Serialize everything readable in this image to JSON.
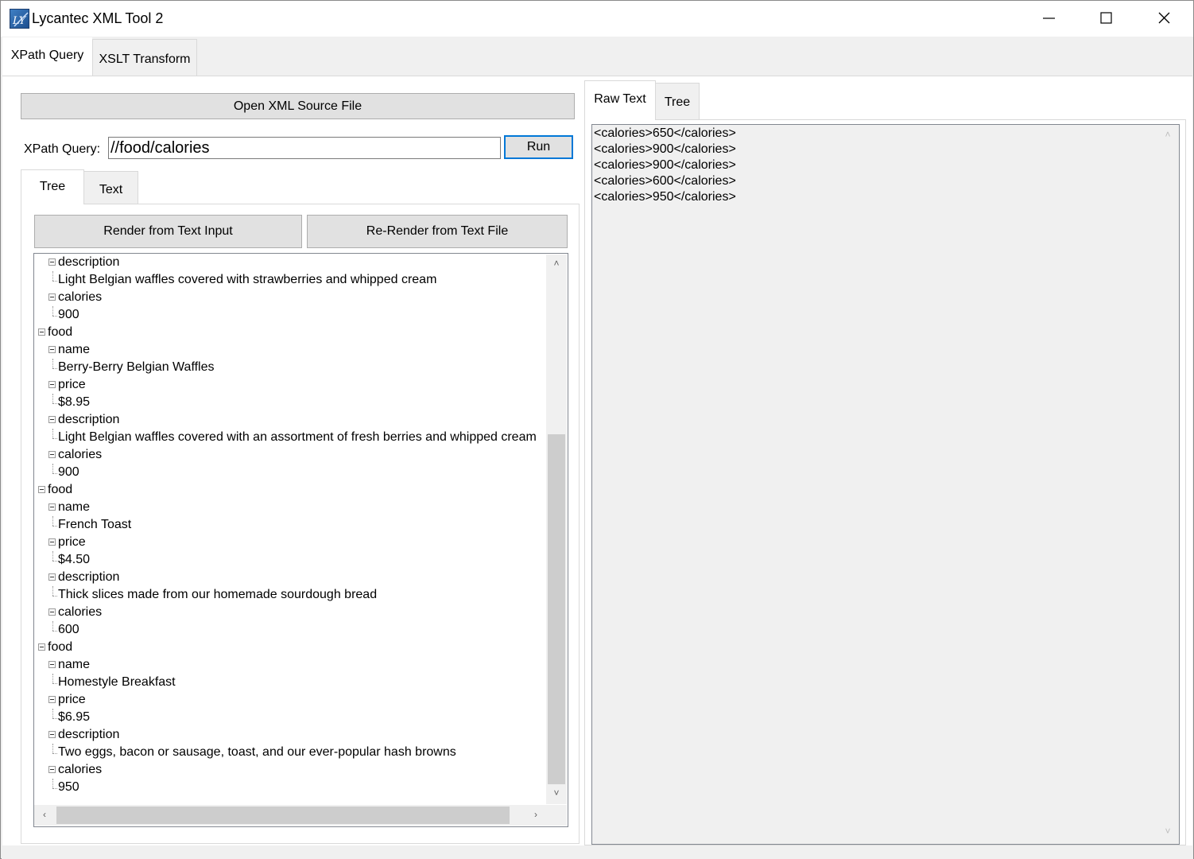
{
  "window": {
    "title": "Lycantec XML Tool 2",
    "icon": "lycantec-logo-icon"
  },
  "top_tabs": [
    {
      "label": "XPath Query",
      "active": true
    },
    {
      "label": "XSLT Transform",
      "active": false
    }
  ],
  "toolbar": {
    "open_button": "Open XML Source File",
    "xpath_label": "XPath Query:",
    "xpath_value": "//food/calories",
    "run_button": "Run"
  },
  "left_tabs": [
    {
      "label": "Tree",
      "active": true
    },
    {
      "label": "Text",
      "active": false
    }
  ],
  "render_buttons": {
    "from_text_input": "Render from Text Input",
    "from_text_file": "Re-Render from Text File"
  },
  "tree": [
    {
      "level": 1,
      "text": "description",
      "node": true
    },
    {
      "level": 2,
      "text": "Light Belgian waffles covered with strawberries and whipped cream",
      "node": false
    },
    {
      "level": 1,
      "text": "calories",
      "node": true
    },
    {
      "level": 2,
      "text": "900",
      "node": false
    },
    {
      "level": 0,
      "text": "food",
      "node": true
    },
    {
      "level": 1,
      "text": "name",
      "node": true
    },
    {
      "level": 2,
      "text": "Berry-Berry Belgian Waffles",
      "node": false
    },
    {
      "level": 1,
      "text": "price",
      "node": true
    },
    {
      "level": 2,
      "text": "$8.95",
      "node": false
    },
    {
      "level": 1,
      "text": "description",
      "node": true
    },
    {
      "level": 2,
      "text": "Light Belgian waffles covered with an assortment of fresh berries and whipped cream",
      "node": false
    },
    {
      "level": 1,
      "text": "calories",
      "node": true
    },
    {
      "level": 2,
      "text": "900",
      "node": false
    },
    {
      "level": 0,
      "text": "food",
      "node": true
    },
    {
      "level": 1,
      "text": "name",
      "node": true
    },
    {
      "level": 2,
      "text": "French Toast",
      "node": false
    },
    {
      "level": 1,
      "text": "price",
      "node": true
    },
    {
      "level": 2,
      "text": "$4.50",
      "node": false
    },
    {
      "level": 1,
      "text": "description",
      "node": true
    },
    {
      "level": 2,
      "text": "Thick slices made from our homemade sourdough bread",
      "node": false
    },
    {
      "level": 1,
      "text": "calories",
      "node": true
    },
    {
      "level": 2,
      "text": "600",
      "node": false
    },
    {
      "level": 0,
      "text": "food",
      "node": true
    },
    {
      "level": 1,
      "text": "name",
      "node": true
    },
    {
      "level": 2,
      "text": "Homestyle Breakfast",
      "node": false
    },
    {
      "level": 1,
      "text": "price",
      "node": true
    },
    {
      "level": 2,
      "text": "$6.95",
      "node": false
    },
    {
      "level": 1,
      "text": "description",
      "node": true
    },
    {
      "level": 2,
      "text": "Two eggs, bacon or sausage, toast, and our ever-popular hash browns",
      "node": false
    },
    {
      "level": 1,
      "text": "calories",
      "node": true
    },
    {
      "level": 2,
      "text": "950",
      "node": false
    }
  ],
  "right_tabs": [
    {
      "label": "Raw Text",
      "active": true
    },
    {
      "label": "Tree",
      "active": false
    }
  ],
  "raw_text": [
    "<calories>650</calories>",
    "<calories>900</calories>",
    "<calories>900</calories>",
    "<calories>600</calories>",
    "<calories>950</calories>"
  ],
  "scrollbars": {
    "tree_vertical_position_fraction": 0.33,
    "tree_horizontal_position_fraction": 0.0
  }
}
